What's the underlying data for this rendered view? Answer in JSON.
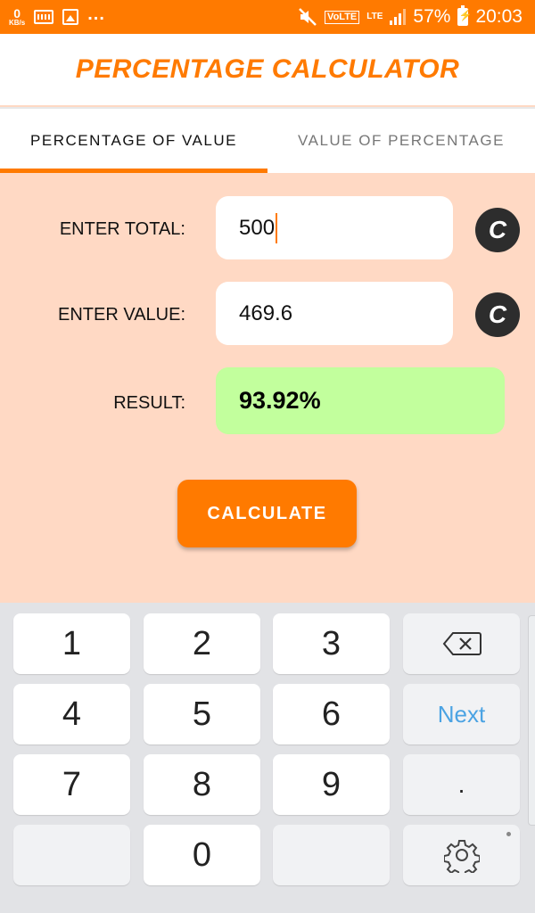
{
  "status_bar": {
    "net_speed_value": "0",
    "net_speed_unit": "KB/s",
    "more_indicator": "...",
    "volte": "VoLTE",
    "lte": "LTE",
    "battery_percent": "57%",
    "time": "20:03",
    "icons": [
      "keyboard-icon",
      "image-icon",
      "mute-icon",
      "signal-icon",
      "battery-charging-icon"
    ]
  },
  "app": {
    "title": "PERCENTAGE CALCULATOR",
    "accent_color": "#ff7a00"
  },
  "tabs": [
    {
      "label": "PERCENTAGE OF VALUE",
      "active": true
    },
    {
      "label": "VALUE OF PERCENTAGE",
      "active": false
    }
  ],
  "form": {
    "total_label": "ENTER TOTAL:",
    "total_value": "500",
    "value_label": "ENTER VALUE:",
    "value_value": "469.6",
    "result_label": "RESULT:",
    "result_value": "93.92%",
    "clear_label": "C",
    "calculate_label": "CALCULATE"
  },
  "keyboard": {
    "keys": [
      "1",
      "2",
      "3",
      "4",
      "5",
      "6",
      "7",
      "8",
      "9",
      "0",
      "."
    ],
    "next_label": "Next",
    "icons": [
      "backspace-icon",
      "gear-icon"
    ]
  }
}
